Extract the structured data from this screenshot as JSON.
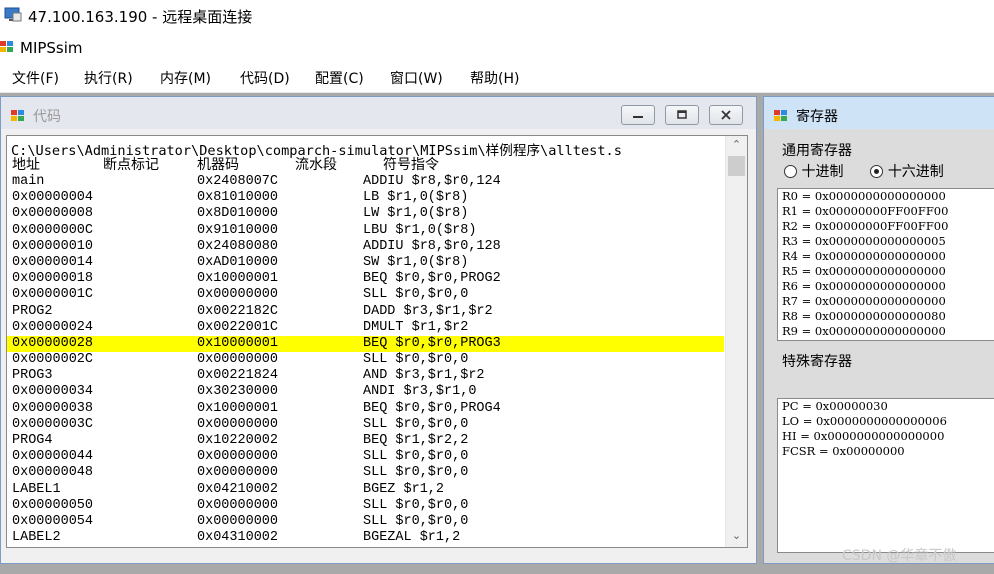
{
  "window": {
    "title": "47.100.163.190 - 远程桌面连接"
  },
  "app": {
    "title": "MIPSsim"
  },
  "menu": [
    "文件(F)",
    "执行(R)",
    "内存(M)",
    "代码(D)",
    "配置(C)",
    "窗口(W)",
    "帮助(H)"
  ],
  "code_window": {
    "title": "代码",
    "path": "C:\\Users\\Administrator\\Desktop\\comparch-simulator\\MIPSsim\\样例程序\\alltest.s",
    "headers": [
      "地址",
      "断点标记",
      "机器码",
      "流水段",
      "符号指令"
    ],
    "highlight_color": "#ffff00",
    "rows": [
      {
        "addr": "main",
        "code": "0x2408007C",
        "instr": "ADDIU $r8,$r0,124"
      },
      {
        "addr": "0x00000004",
        "code": "0x81010000",
        "instr": "LB $r1,0($r8)"
      },
      {
        "addr": "0x00000008",
        "code": "0x8D010000",
        "instr": "LW $r1,0($r8)"
      },
      {
        "addr": "0x0000000C",
        "code": "0x91010000",
        "instr": "LBU $r1,0($r8)"
      },
      {
        "addr": "0x00000010",
        "code": "0x24080080",
        "instr": "ADDIU $r8,$r0,128"
      },
      {
        "addr": "0x00000014",
        "code": "0xAD010000",
        "instr": "SW $r1,0($r8)"
      },
      {
        "addr": "0x00000018",
        "code": "0x10000001",
        "instr": "BEQ $r0,$r0,PROG2"
      },
      {
        "addr": "0x0000001C",
        "code": "0x00000000",
        "instr": "SLL $r0,$r0,0"
      },
      {
        "addr": "PROG2",
        "code": "0x0022182C",
        "instr": "DADD $r3,$r1,$r2"
      },
      {
        "addr": "0x00000024",
        "code": "0x0022001C",
        "instr": "DMULT $r1,$r2"
      },
      {
        "addr": "0x00000028",
        "code": "0x10000001",
        "instr": "BEQ $r0,$r0,PROG3",
        "highlight": true
      },
      {
        "addr": "0x0000002C",
        "code": "0x00000000",
        "instr": "SLL $r0,$r0,0"
      },
      {
        "addr": "PROG3",
        "code": "0x00221824",
        "instr": "AND $r3,$r1,$r2"
      },
      {
        "addr": "0x00000034",
        "code": "0x30230000",
        "instr": "ANDI $r3,$r1,0"
      },
      {
        "addr": "0x00000038",
        "code": "0x10000001",
        "instr": "BEQ $r0,$r0,PROG4"
      },
      {
        "addr": "0x0000003C",
        "code": "0x00000000",
        "instr": "SLL $r0,$r0,0"
      },
      {
        "addr": "PROG4",
        "code": "0x10220002",
        "instr": "BEQ $r1,$r2,2"
      },
      {
        "addr": "0x00000044",
        "code": "0x00000000",
        "instr": "SLL $r0,$r0,0"
      },
      {
        "addr": "0x00000048",
        "code": "0x00000000",
        "instr": "SLL $r0,$r0,0"
      },
      {
        "addr": "LABEL1",
        "code": "0x04210002",
        "instr": "BGEZ $r1,2"
      },
      {
        "addr": "0x00000050",
        "code": "0x00000000",
        "instr": "SLL $r0,$r0,0"
      },
      {
        "addr": "0x00000054",
        "code": "0x00000000",
        "instr": "SLL $r0,$r0,0"
      },
      {
        "addr": "LABEL2",
        "code": "0x04310002",
        "instr": "BGEZAL $r1,2"
      }
    ]
  },
  "register_window": {
    "title": "寄存器",
    "general_label": "通用寄存器",
    "radix_options": [
      "十进制",
      "十六进制"
    ],
    "radix_selected": "十六进制",
    "general": [
      "R0 = 0x0000000000000000",
      "R1 = 0x00000000FF00FF00",
      "R2 = 0x00000000FF00FF00",
      "R3 = 0x0000000000000005",
      "R4 = 0x0000000000000000",
      "R5 = 0x0000000000000000",
      "R6 = 0x0000000000000000",
      "R7 = 0x0000000000000000",
      "R8 = 0x0000000000000080",
      "R9 = 0x0000000000000000"
    ],
    "special_label": "特殊寄存器",
    "special": [
      "PC = 0x00000030",
      "LO = 0x0000000000000006",
      "HI = 0x0000000000000000",
      "FCSR = 0x00000000"
    ]
  },
  "watermark": "CSDN @华章不傲"
}
